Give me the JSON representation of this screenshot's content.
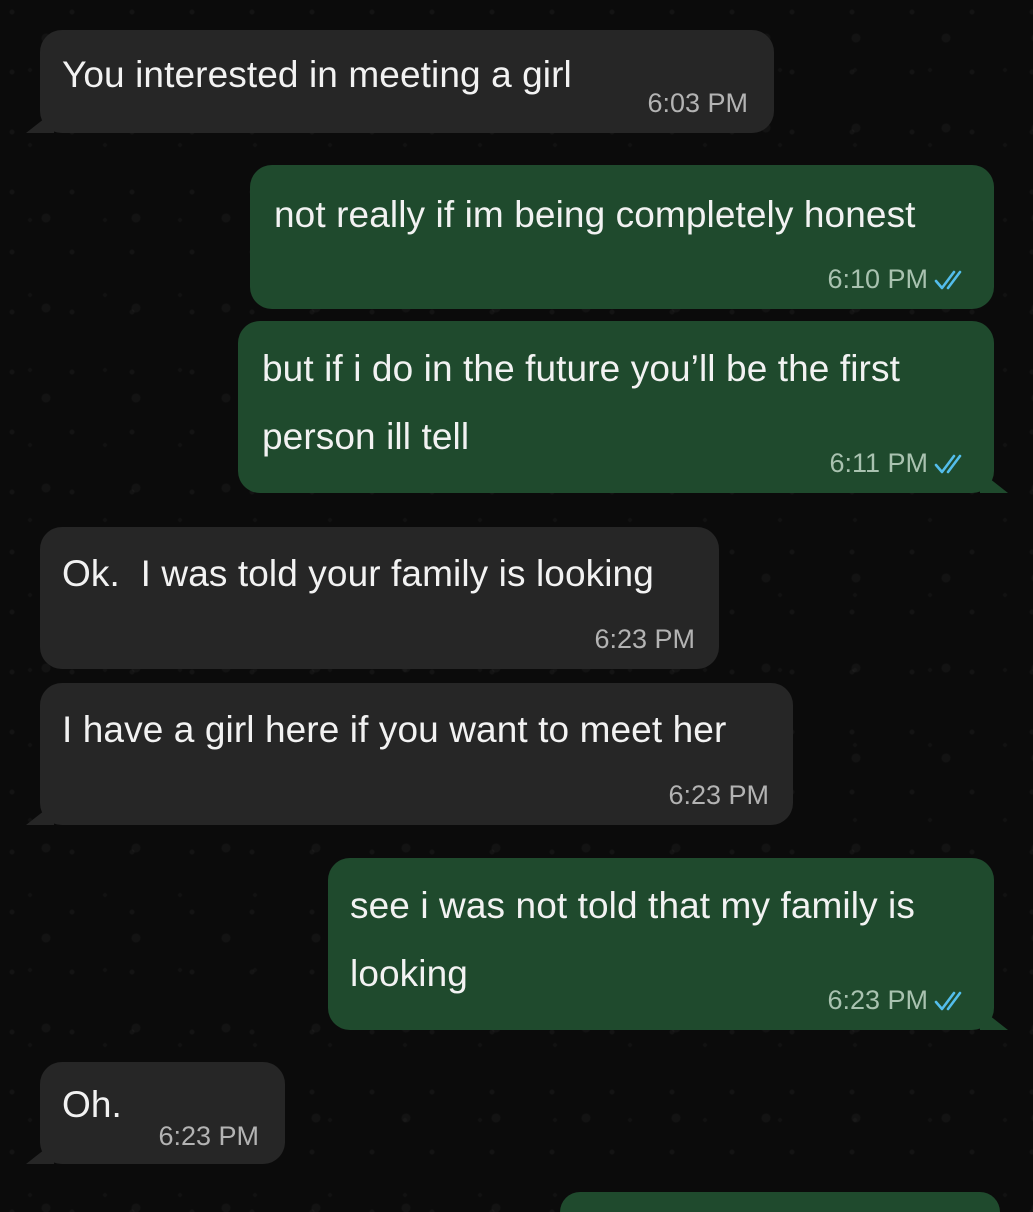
{
  "chat": {
    "messages": [
      {
        "direction": "incoming",
        "text": "You interested in meeting a girl",
        "time": "6:03 PM"
      },
      {
        "direction": "outgoing",
        "text": "not really if im being completely honest",
        "time": "6:10 PM",
        "status": "read"
      },
      {
        "direction": "outgoing",
        "lines": [
          "but if i do in the future you’ll be the first",
          "person ill tell"
        ],
        "time": "6:11 PM",
        "status": "read"
      },
      {
        "direction": "incoming",
        "text": "Ok.  I was told your family is looking",
        "time": "6:23 PM"
      },
      {
        "direction": "incoming",
        "text": "I have a girl here if you want to meet her",
        "time": "6:23 PM"
      },
      {
        "direction": "outgoing",
        "lines": [
          "see i was not told that my family is",
          "looking"
        ],
        "time": "6:23 PM",
        "status": "read"
      },
      {
        "direction": "incoming",
        "text": "Oh.",
        "time": "6:23 PM"
      }
    ]
  },
  "colors": {
    "background": "#0b0b0b",
    "incoming_bubble": "#262626",
    "outgoing_bubble": "#1f4a2d",
    "read_receipt": "#53bdeb"
  },
  "icons": {
    "read_receipt": "double-check-icon"
  }
}
